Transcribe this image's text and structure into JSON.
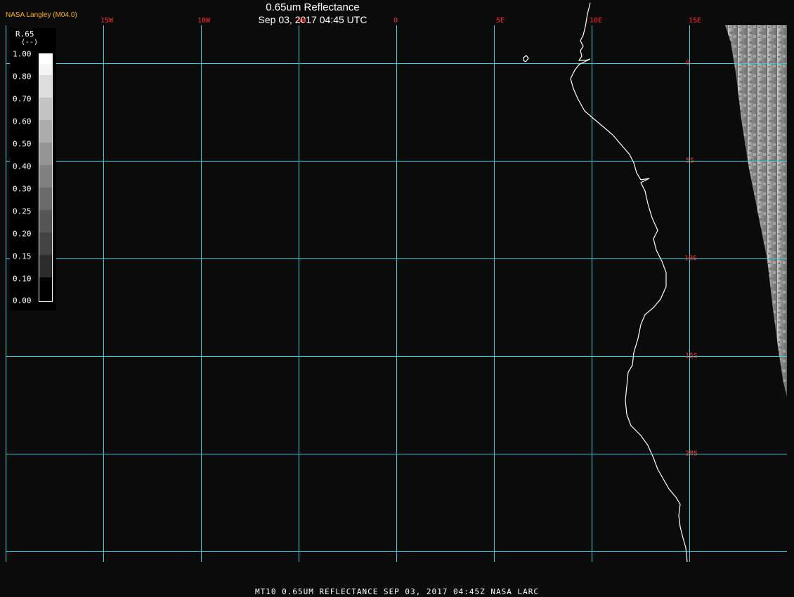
{
  "header": {
    "producer": "NASA Langley (M04.0)",
    "title": "0.65um Reflectance",
    "subtitle": "Sep 03, 2017 04:45 UTC"
  },
  "map": {
    "longitude_labels": [
      "15W",
      "10W",
      "5W",
      "0",
      "5E",
      "10E",
      "15E"
    ],
    "longitude_values": [
      -15,
      -10,
      -5,
      0,
      5,
      10,
      15
    ],
    "latitude_labels": [
      "0",
      "5S",
      "10S",
      "15S",
      "20S"
    ],
    "latitude_values": [
      0,
      -5,
      -10,
      -15,
      -20
    ],
    "grid_color": "#35d0e0",
    "label_color": "#ff3030",
    "coastline_color": "#ffffff"
  },
  "legend": {
    "variable": "R.65",
    "unit": "(--)",
    "ticks": [
      "1.00",
      "0.80",
      "0.70",
      "0.60",
      "0.50",
      "0.40",
      "0.30",
      "0.25",
      "0.20",
      "0.15",
      "0.10",
      "0.00"
    ]
  },
  "footer": {
    "text": "MT10  0.65UM REFLECTANCE   SEP 03, 2017 04:45Z   NASA LARC"
  }
}
